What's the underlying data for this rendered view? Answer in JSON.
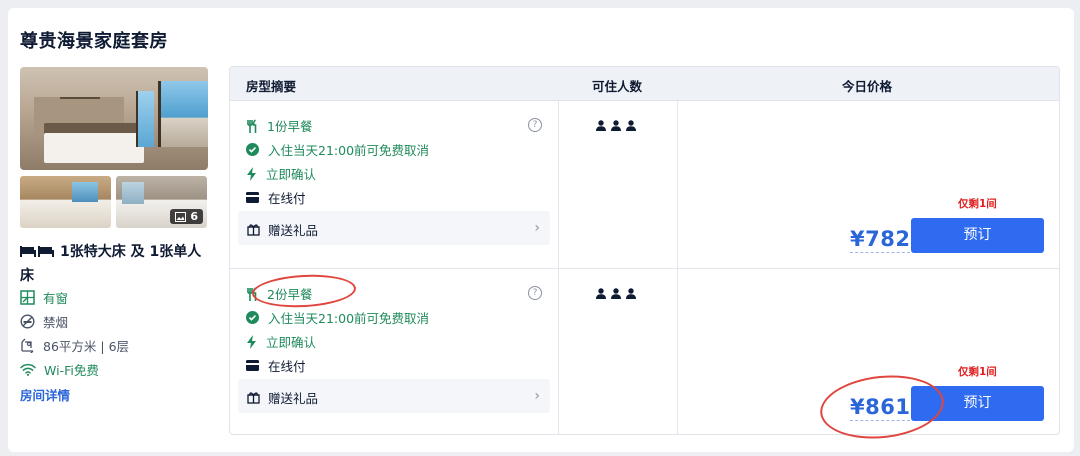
{
  "room": {
    "title": "尊贵海景家庭套房",
    "photo_count": "6",
    "bed_desc": "1张特大床 及 1张单人床",
    "features": [
      {
        "icon": "window-icon",
        "text": "有窗",
        "color": "green"
      },
      {
        "icon": "no-smoking-icon",
        "text": "禁烟",
        "color": "gray"
      },
      {
        "icon": "area-icon",
        "text": "86平方米 | 6层",
        "color": "gray"
      },
      {
        "icon": "wifi-icon",
        "text": "Wi-Fi免费",
        "color": "green"
      }
    ],
    "details_link": "房间详情"
  },
  "table": {
    "headers": {
      "summary": "房型摘要",
      "guests": "可住人数",
      "price": "今日价格"
    },
    "rows": [
      {
        "breakfast": "1份早餐",
        "cancel": "入住当天21:00前可免费取消",
        "confirm": "立即确认",
        "payment": "在线付",
        "gift": "赠送礼品",
        "help": "?",
        "remaining": "仅剩1间",
        "price": "¥782",
        "book_label": "预订"
      },
      {
        "breakfast": "2份早餐",
        "cancel": "入住当天21:00前可免费取消",
        "confirm": "立即确认",
        "payment": "在线付",
        "gift": "赠送礼品",
        "help": "?",
        "remaining": "仅剩1间",
        "price": "¥861",
        "book_label": "预订"
      }
    ]
  },
  "colors": {
    "accent": "#2f6bf0",
    "price": "#2b66d9",
    "green": "#1f8a5b",
    "alert": "#e02020",
    "annotation": "#e0463e"
  }
}
